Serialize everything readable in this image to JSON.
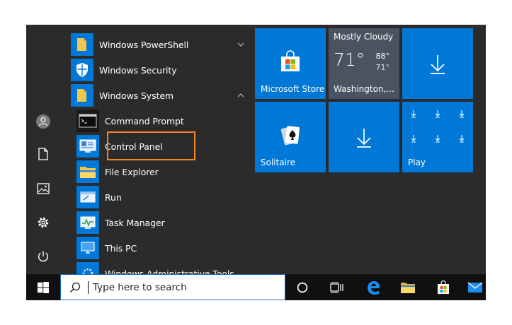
{
  "app_list": [
    {
      "label": "Windows PowerShell",
      "chevron": "down"
    },
    {
      "label": "Windows Security",
      "chevron": ""
    },
    {
      "label": "Windows System",
      "chevron": "up"
    },
    {
      "label": "Command Prompt"
    },
    {
      "label": "Control Panel",
      "highlighted": true
    },
    {
      "label": "File Explorer"
    },
    {
      "label": "Run"
    },
    {
      "label": "Task Manager"
    },
    {
      "label": "This PC"
    },
    {
      "label": "Windows Administrative Tools"
    }
  ],
  "tiles": {
    "store": {
      "label": "Microsoft Store"
    },
    "weather": {
      "condition": "Mostly Cloudy",
      "temp": "71°",
      "high": "88°",
      "low": "71°",
      "city": "Washington,..."
    },
    "solitaire": {
      "label": "Solitaire"
    },
    "play": {
      "label": "Play"
    }
  },
  "search": {
    "placeholder": "Type here to search"
  },
  "colors": {
    "accent": "#0078d7",
    "highlight": "#f68421",
    "weather_tile": "#4a5360",
    "menu_bg": "#2b2b2b",
    "taskbar_bg": "#101010"
  }
}
